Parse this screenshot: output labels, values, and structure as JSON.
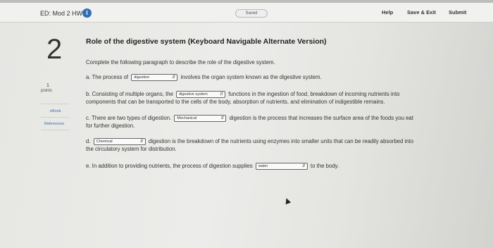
{
  "header": {
    "title": "ED: Mod 2 HW",
    "info_icon": "i",
    "saved": "Saved",
    "help": "Help",
    "save_exit": "Save & Exit",
    "submit": "Submit"
  },
  "sidebar": {
    "question_number": "2",
    "points_value": "1",
    "points_label": "points",
    "ebook": "eBook",
    "references": "References"
  },
  "question": {
    "title": "Role of the digestive system (Keyboard Navigable Alternate Version)",
    "instructions": "Complete the following paragraph to describe the role of the digestive system.",
    "a": {
      "pre": "a. The process of",
      "select": "digestion",
      "post": "involves the organ system known as the digestive system."
    },
    "b": {
      "pre": "b. Consisting of multiple organs, the",
      "select": "digestive system",
      "post": "functions in the ingestion of food, breakdown of incoming nutrients into",
      "line2": "components that can be transported to the cells of the body, absorption of nutrients, and elimination of indigestible remains."
    },
    "c": {
      "pre": "c. There are two types of digestion.",
      "select": "Mechanical",
      "post": "digestion is the process that increases the surface area of the foods you eat",
      "line2": "for further digestion."
    },
    "d": {
      "pre": "d.",
      "select": "Chemical",
      "post": "digestion is the breakdown of the nutrients using enzymes into smaller units that can be readily absorbed into",
      "line2": "the circulatory system for distribution."
    },
    "e": {
      "pre": "e. In addition to providing nutrients, the process of digestion supplies",
      "select": "water",
      "post": "to the body."
    }
  },
  "colors": {
    "accent": "#2f6fb3",
    "link": "#3a6fa8"
  }
}
